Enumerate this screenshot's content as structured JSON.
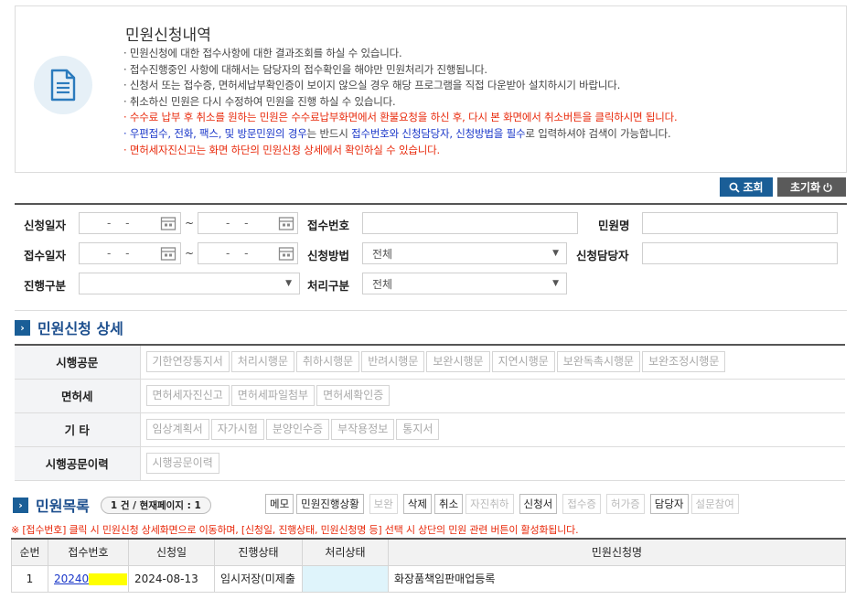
{
  "info": {
    "title": "민원신청내역",
    "icon": "document-icon",
    "line1": "· 민원신청에 대한 접수사항에 대한 결과조회를 하실 수 있습니다.",
    "line2": "· 접수진행중인 사항에 대해서는 담당자의 접수확인을 해야만 민원처리가 진행됩니다.",
    "line3": "· 신청서 또는 접수증, 면허세납부확인증이 보이지 않으실 경우 해당 프로그램을 직접 다운받아 설치하시기 바랍니다.",
    "line4": "· 취소하신 민원은 다시 수정하여 민원을 진행 하실 수 있습니다.",
    "line5": "· 수수료 납부 후 취소를 원하는 민원은 수수료납부화면에서 환불요청을 하신 후, 다시 본 화면에서 취소버튼을 클릭하시면 됩니다.",
    "line6_a": "· 우편접수, 전화, 팩스, 및 방문민원의 경우",
    "line6_b": "는 반드시 ",
    "line6_c": "접수번호와 신청담당자, 신청방법을 필수",
    "line6_d": "로 입력하셔야 검색이 가능합니다.",
    "line7": "· 면허세자진신고는 화면 하단의 민원신청 상세에서 확인하실 수 있습니다."
  },
  "actions": {
    "search": "조회",
    "reset": "초기화"
  },
  "form": {
    "apply_date_label": "신청일자",
    "receipt_date_label": "접수일자",
    "progress_label": "진행구분",
    "receipt_no_label": "접수번호",
    "method_label": "신청방법",
    "process_label": "처리구분",
    "civil_name_label": "민원명",
    "officer_label": "신청담당자",
    "date_placeholder": "- -",
    "tilde": "~",
    "method_value": "전체",
    "process_value": "전체"
  },
  "detail": {
    "title": "민원신청 상세",
    "rows": [
      {
        "header": "시행공문",
        "buttons": [
          "기한연장통지서",
          "처리시행문",
          "취하시행문",
          "반려시행문",
          "보완시행문",
          "지연시행문",
          "보완독촉시행문",
          "보완조정시행문"
        ]
      },
      {
        "header": "면허세",
        "buttons": [
          "면허세자진신고",
          "면허세파일첨부",
          "면허세확인증"
        ]
      },
      {
        "header": "기 타",
        "buttons": [
          "임상계획서",
          "자가시험",
          "분양인수증",
          "부작용정보",
          "통지서"
        ]
      },
      {
        "header": "시행공문이력",
        "buttons": [
          "시행공문이력"
        ]
      }
    ]
  },
  "list": {
    "title": "민원목록",
    "count": "1 건 / 현재페이지 : 1",
    "buttons": [
      {
        "label": "메모",
        "disabled": false
      },
      {
        "label": "민원진행상황",
        "disabled": false
      },
      {
        "label": "보완",
        "disabled": true
      },
      {
        "label": "삭제",
        "disabled": false
      },
      {
        "label": "취소",
        "disabled": false
      },
      {
        "label": "자진취하",
        "disabled": true
      },
      {
        "label": "신청서",
        "disabled": false
      },
      {
        "label": "접수증",
        "disabled": true
      },
      {
        "label": "허가증",
        "disabled": true
      },
      {
        "label": "담당자",
        "disabled": false
      },
      {
        "label": "설문참여",
        "disabled": true
      }
    ],
    "notice": "※ [접수번호] 클릭 시 민원신청 상세화면으로 이동하며, [신청일, 진행상태, 민원신청명 등] 선택 시 상단의 민원 관련 버튼이 활성화됩니다.",
    "columns": [
      "순번",
      "접수번호",
      "신청일",
      "진행상태",
      "처리상태",
      "민원신청명"
    ],
    "rows": [
      {
        "no": "1",
        "receipt_no": "20240",
        "apply_date": "2024-08-13",
        "status": "임시저장(미제출",
        "process": "",
        "name": "화장품책임판매업등록"
      }
    ]
  }
}
